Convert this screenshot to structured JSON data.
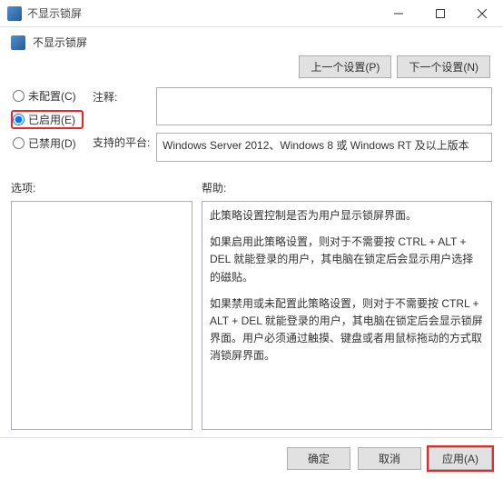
{
  "window": {
    "title": "不显示锁屏"
  },
  "header": {
    "title": "不显示锁屏"
  },
  "nav": {
    "prev": "上一个设置(P)",
    "next": "下一个设置(N)"
  },
  "radios": {
    "unconfigured": "未配置(C)",
    "enabled": "已启用(E)",
    "disabled": "已禁用(D)"
  },
  "labels": {
    "comment": "注释:",
    "platform": "支持的平台:",
    "options": "选项:",
    "help": "帮助:"
  },
  "platform_text": "Windows Server 2012、Windows 8 或 Windows RT 及以上版本",
  "help_text": {
    "p1": "此策略设置控制是否为用户显示锁屏界面。",
    "p2": "如果启用此策略设置，则对于不需要按 CTRL + ALT + DEL 就能登录的用户，其电脑在锁定后会显示用户选择的磁贴。",
    "p3": "如果禁用或未配置此策略设置，则对于不需要按 CTRL + ALT + DEL 就能登录的用户，其电脑在锁定后会显示锁屏界面。用户必须通过触摸、键盘或者用鼠标拖动的方式取消锁屏界面。"
  },
  "footer": {
    "ok": "确定",
    "cancel": "取消",
    "apply": "应用(A)"
  }
}
